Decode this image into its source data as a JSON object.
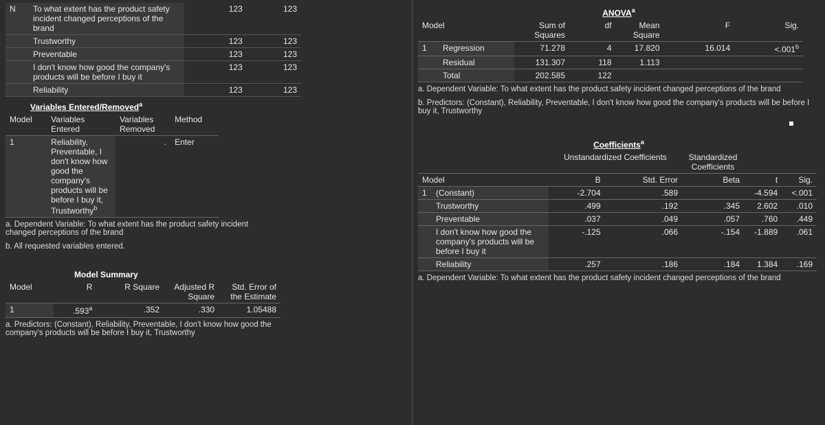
{
  "top": {
    "rows": [
      {
        "label": "N",
        "desc": "To what extent has the product safety incident changed perceptions of the brand",
        "c1": "123",
        "c2": "123"
      },
      {
        "label": "",
        "desc": "Trustworthy",
        "c1": "123",
        "c2": "123"
      },
      {
        "label": "",
        "desc": "Preventable",
        "c1": "123",
        "c2": "123"
      },
      {
        "label": "",
        "desc": "I don't know how good the company's products will be before I buy it",
        "c1": "123",
        "c2": "123"
      },
      {
        "label": "",
        "desc": "Reliability",
        "c1": "123",
        "c2": "123"
      }
    ]
  },
  "varsEntered": {
    "title": "Variables Entered/Removed",
    "headers": {
      "model": "Model",
      "entered": "Variables Entered",
      "removed": "Variables Removed",
      "method": "Method"
    },
    "row": {
      "model": "1",
      "entered": "Reliability, Preventable, I don't know how good the company's products will be before I buy it, Trustworthy",
      "removed": ".",
      "method": "Enter"
    },
    "noteA": "a. Dependent Variable: To what extent has the product safety incident changed perceptions of the brand",
    "noteB": "b. All requested variables entered."
  },
  "modelSummary": {
    "title": "Model Summary",
    "headers": {
      "model": "Model",
      "r": "R",
      "r2": "R Square",
      "adj": "Adjusted R Square",
      "stderr": "Std. Error of the Estimate"
    },
    "row": {
      "model": "1",
      "r": ".593",
      "r2": ".352",
      "adj": ".330",
      "stderr": "1.05488"
    },
    "noteA": "a. Predictors: (Constant), Reliability, Preventable, I don't know how good the company's products will be before I buy it, Trustworthy"
  },
  "anova": {
    "title": "ANOVA",
    "headers": {
      "model": "Model",
      "ss": "Sum of Squares",
      "df": "df",
      "ms": "Mean Square",
      "f": "F",
      "sig": "Sig."
    },
    "rows": [
      {
        "model": "1",
        "name": "Regression",
        "ss": "71.278",
        "df": "4",
        "ms": "17.820",
        "f": "16.014",
        "sig": "<.001"
      },
      {
        "model": "",
        "name": "Residual",
        "ss": "131.307",
        "df": "118",
        "ms": "1.113",
        "f": "",
        "sig": ""
      },
      {
        "model": "",
        "name": "Total",
        "ss": "202.585",
        "df": "122",
        "ms": "",
        "f": "",
        "sig": ""
      }
    ],
    "noteA": "a. Dependent Variable: To what extent has the product safety incident changed perceptions of the brand",
    "noteB": "b. Predictors: (Constant), Reliability, Preventable, I don't know how good the company's products will be before I buy it, Trustworthy"
  },
  "coef": {
    "title": "Coefficients",
    "group1": "Unstandardized Coefficients",
    "group2": "Standardized Coefficients",
    "headers": {
      "model": "Model",
      "b": "B",
      "se": "Std. Error",
      "beta": "Beta",
      "t": "t",
      "sig": "Sig."
    },
    "rows": [
      {
        "model": "1",
        "name": "(Constant)",
        "b": "-2.704",
        "se": ".589",
        "beta": "",
        "t": "-4.594",
        "sig": "<.001"
      },
      {
        "model": "",
        "name": "Trustworthy",
        "b": ".499",
        "se": ".192",
        "beta": ".345",
        "t": "2.602",
        "sig": ".010"
      },
      {
        "model": "",
        "name": "Preventable",
        "b": ".037",
        "se": ".049",
        "beta": ".057",
        "t": ".760",
        "sig": ".449"
      },
      {
        "model": "",
        "name": "I don't know how good the company's products will be before I buy it",
        "b": "-.125",
        "se": ".066",
        "beta": "-.154",
        "t": "-1.889",
        "sig": ".061"
      },
      {
        "model": "",
        "name": "Reliability",
        "b": ".257",
        "se": ".186",
        "beta": ".184",
        "t": "1.384",
        "sig": ".169"
      }
    ],
    "noteA": "a. Dependent Variable: To what extent has the product safety incident changed perceptions of the brand"
  }
}
